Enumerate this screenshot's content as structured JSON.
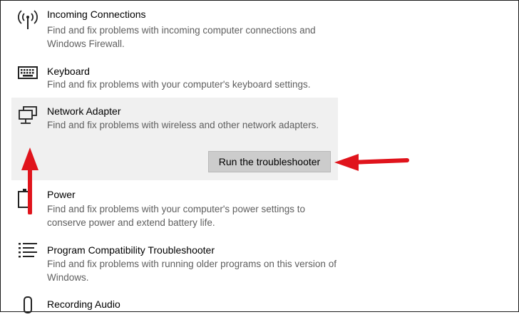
{
  "items": [
    {
      "title": "Incoming Connections",
      "desc": "Find and fix problems with incoming computer connections and Windows Firewall.",
      "icon": "antenna-icon"
    },
    {
      "title": "Keyboard",
      "desc": "Find and fix problems with your computer's keyboard settings.",
      "icon": "keyboard-icon"
    },
    {
      "title": "Network Adapter",
      "desc": "Find and fix problems with wireless and other network adapters.",
      "icon": "network-icon"
    },
    {
      "title": "Power",
      "desc": "Find and fix problems with your computer's power settings to conserve power and extend battery life.",
      "icon": "battery-icon"
    },
    {
      "title": "Program Compatibility Troubleshooter",
      "desc": "Find and fix problems with running older programs on this version of Windows.",
      "icon": "list-icon"
    },
    {
      "title": "Recording Audio",
      "icon": "microphone-icon"
    }
  ],
  "run_button_label": "Run the troubleshooter",
  "colors": {
    "selected_bg": "#f0f0f0",
    "button_bg": "#cccccc",
    "arrow": "#e0141c"
  }
}
